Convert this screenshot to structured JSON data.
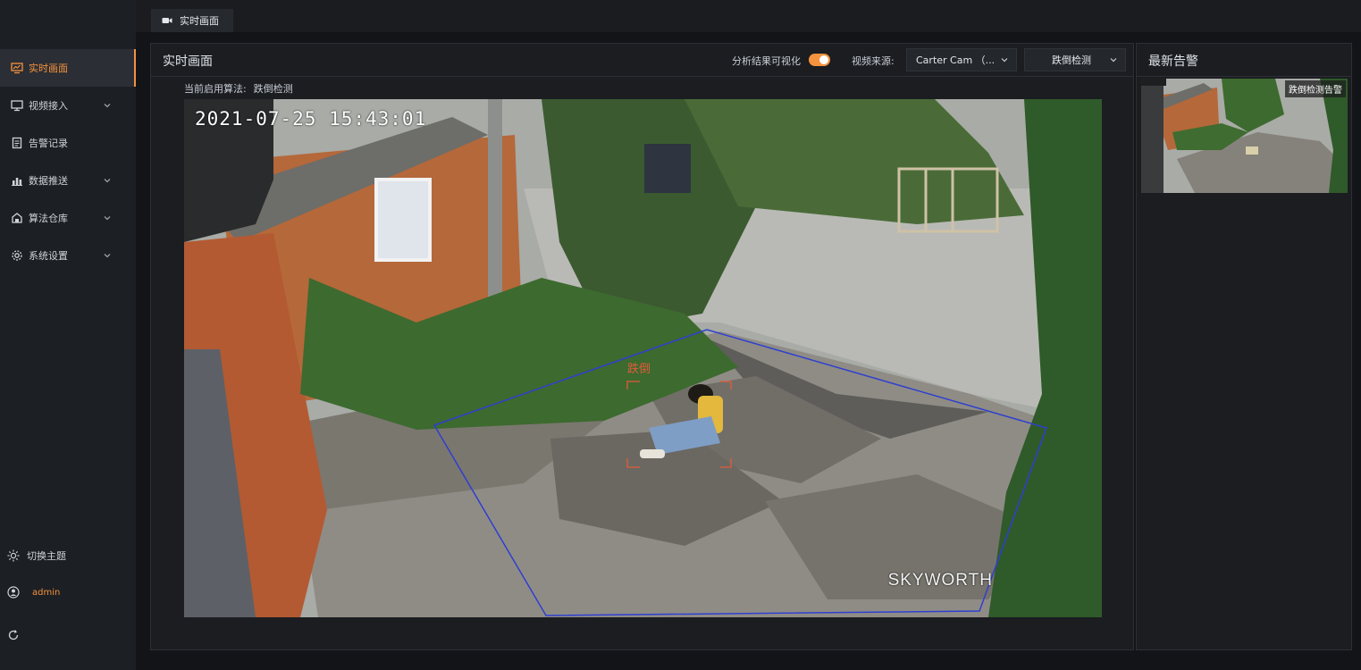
{
  "sidebar": {
    "items": [
      {
        "label": "实时画面",
        "icon": "monitor-chart-icon",
        "active": true,
        "has_children": false
      },
      {
        "label": "视频接入",
        "icon": "monitor-icon",
        "active": false,
        "has_children": true
      },
      {
        "label": "告警记录",
        "icon": "document-icon",
        "active": false,
        "has_children": false
      },
      {
        "label": "数据推送",
        "icon": "bar-chart-icon",
        "active": false,
        "has_children": true
      },
      {
        "label": "算法仓库",
        "icon": "warehouse-icon",
        "active": false,
        "has_children": true
      },
      {
        "label": "系统设置",
        "icon": "gear-icon",
        "active": false,
        "has_children": true
      }
    ],
    "theme_label": "切换主题",
    "user_label": "admin"
  },
  "tabs": [
    {
      "label": "实时画面"
    }
  ],
  "live": {
    "title": "实时画面",
    "viz_toggle_label": "分析结果可视化",
    "viz_toggle_on": true,
    "source_label": "视频来源:",
    "source_value": "Carter Cam （...",
    "algo_select_value": "跌倒检测",
    "current_algo_label": "当前启用算法:",
    "current_algo_value": "跌倒检测",
    "timestamp": "2021-07-25  15:43:01",
    "watermark": "SKYWORTH",
    "detection_label": "跌倒"
  },
  "alerts": {
    "title": "最新告警",
    "items": [
      {
        "label": "跌倒检测告警"
      }
    ]
  },
  "colors": {
    "accent": "#f5923e",
    "detection_box": "#e25b3b",
    "roi": "#2f3fd0"
  }
}
